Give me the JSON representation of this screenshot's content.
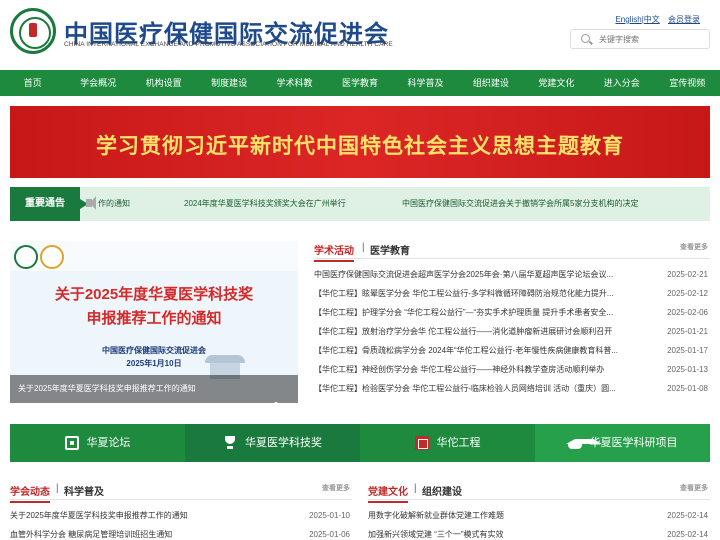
{
  "header": {
    "title": "中国医疗保健国际交流促进会",
    "subtitle": "CHINA INTERNATIONAL EXCHANGE AND PROMOTIVE ASSOCIATION FOR MEDICAL AND HEALTH CARE",
    "english_link": "English",
    "chinese_link": "中文",
    "member_login": "会员登录",
    "search_placeholder": "关键字搜索"
  },
  "nav": [
    "首页",
    "学会概况",
    "机构设置",
    "制度建设",
    "学术科教",
    "医学教育",
    "科学普及",
    "组织建设",
    "党建文化",
    "进入分会",
    "宣传视频"
  ],
  "banner": {
    "text": "学习贯彻习近平新时代中国特色社会主义思想主题教育"
  },
  "notice": {
    "label": "重要通告",
    "items": [
      "作的通知",
      "2024年度华夏医学科技奖颁奖大会在广州举行",
      "中国医疗保健国际交流促进会关于撤销学会所属5家分支机构的决定"
    ]
  },
  "slider": {
    "title_line1": "关于2025年度华夏医学科技奖",
    "title_line2": "申报推荐工作的通知",
    "org": "中国医疗保健国际交流促进会",
    "date": "2025年1月10日",
    "caption": "关于2025年度华夏医学科技奖申报推荐工作的通知"
  },
  "news": {
    "tab_active": "学术活动",
    "tab_other": "医学教育",
    "more": "查看更多",
    "items": [
      {
        "title": "中国医疗保健国际交流促进会超声医学分会2025年会·第八届华夏超声医学论坛会议...",
        "date": "2025-02-21"
      },
      {
        "title": "【华佗工程】眩晕医学分会 华佗工程公益行-多学科微循环障碍防治规范化能力提升...",
        "date": "2025-02-12"
      },
      {
        "title": "【华佗工程】护理学分会 “华佗工程公益行”—“夯实手术护理质量 提升手术患者安全...",
        "date": "2025-02-06"
      },
      {
        "title": "【华佗工程】放射治疗学分会华 佗工程公益行——消化道肿瘤新进展研讨会顺利召开",
        "date": "2025-01-21"
      },
      {
        "title": "【华佗工程】骨质疏松病学分会 2024年“华佗工程公益行-老年慢性疾病健康教育科普...",
        "date": "2025-01-17"
      },
      {
        "title": "【华佗工程】神经创伤学分会 华佗工程公益行——神经外科教学查房活动顺利举办",
        "date": "2025-01-13"
      },
      {
        "title": "【华佗工程】检验医学分会 华佗工程公益行-临床检验人员网络培训 活动（重庆）圆...",
        "date": "2025-01-08"
      }
    ]
  },
  "features": [
    {
      "label": "华夏论坛",
      "icon": "forum-icon",
      "color": "#1e8a3e"
    },
    {
      "label": "华夏医学科技奖",
      "icon": "trophy-icon",
      "color": "#1a7a3d"
    },
    {
      "label": "华佗工程",
      "icon": "huatuo-icon",
      "color": "#1e8a3e"
    },
    {
      "label": "华夏医学科研项目",
      "icon": "graduation-cap-icon",
      "color": "#26a04a"
    }
  ],
  "bottom_left": {
    "tab_active": "学会动态",
    "tab_other": "科学普及",
    "more": "查看更多",
    "items": [
      {
        "title": "关于2025年度华夏医学科技奖申报推荐工作的通知",
        "date": "2025-01-10"
      },
      {
        "title": "血管外科学分会 糖尿病足管理培训班招生通知",
        "date": "2025-01-06"
      }
    ]
  },
  "bottom_right": {
    "tab_active": "党建文化",
    "tab_other": "组织建设",
    "more": "查看更多",
    "items": [
      {
        "title": "用数字化破解新就业群体党建工作难题",
        "date": "2025-02-14"
      },
      {
        "title": "加强新兴领域党建 “三个一”模式有实效",
        "date": "2025-02-14"
      }
    ]
  }
}
